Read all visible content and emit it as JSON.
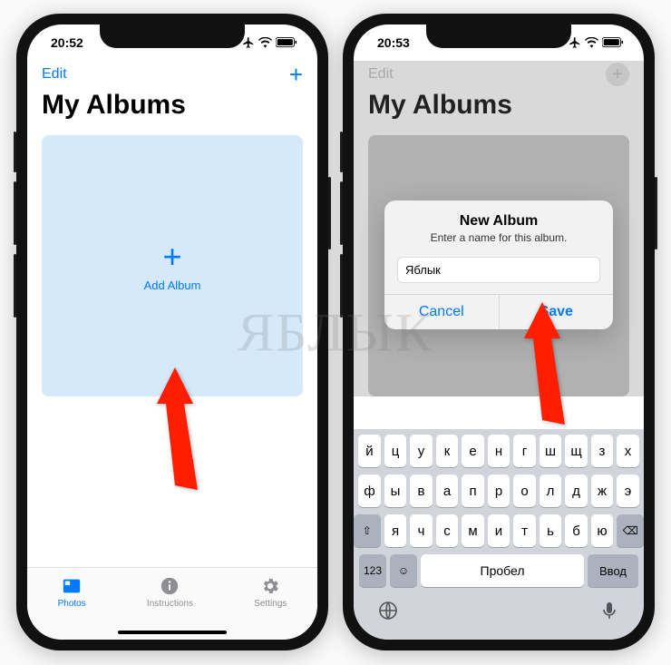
{
  "watermark": "ЯБЛЫК",
  "phone_left": {
    "status": {
      "time": "20:52"
    },
    "nav": {
      "edit": "Edit",
      "add": "+"
    },
    "title": "My Albums",
    "tile": {
      "plus": "+",
      "label": "Add Album"
    },
    "tabs": {
      "photos": "Photos",
      "instructions": "Instructions",
      "settings": "Settings"
    }
  },
  "phone_right": {
    "status": {
      "time": "20:53"
    },
    "nav": {
      "edit": "Edit",
      "add": "+"
    },
    "title": "My Albums",
    "alert": {
      "title": "New Album",
      "message": "Enter a name for this album.",
      "input_value": "Яблык",
      "cancel": "Cancel",
      "save": "Save"
    },
    "keyboard": {
      "row1": [
        "й",
        "ц",
        "у",
        "к",
        "е",
        "н",
        "г",
        "ш",
        "щ",
        "з",
        "х"
      ],
      "row2": [
        "ф",
        "ы",
        "в",
        "а",
        "п",
        "р",
        "о",
        "л",
        "д",
        "ж",
        "э"
      ],
      "row3_shift": "⇧",
      "row3": [
        "я",
        "ч",
        "с",
        "м",
        "и",
        "т",
        "ь",
        "б",
        "ю"
      ],
      "row3_del": "⌫",
      "fn_123": "123",
      "fn_emoji": "☺",
      "space": "Пробел",
      "enter": "Ввод",
      "globe": "🌐",
      "mic": "🎤"
    }
  }
}
